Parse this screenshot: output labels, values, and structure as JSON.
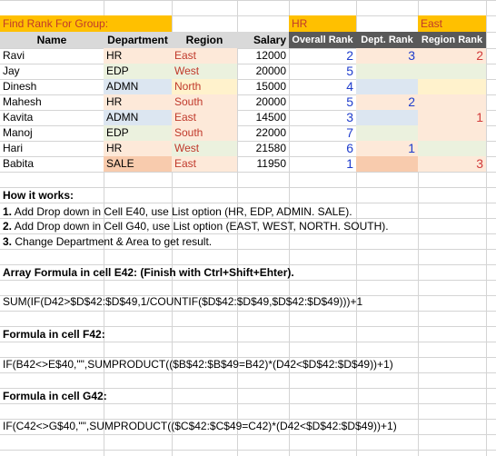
{
  "sheet": {
    "title": "Find Rank For Group:",
    "selected_department": "HR",
    "selected_region": "East",
    "headers": [
      "Name",
      "Department",
      "Region",
      "Salary",
      "Overall Rank",
      "Dept. Rank",
      "Region Rank"
    ],
    "rows": [
      {
        "name": "Ravi",
        "dept": "HR",
        "region": "East",
        "salary": "12000",
        "overall": "2",
        "dept_rank": "3",
        "region_rank": "2"
      },
      {
        "name": "Jay",
        "dept": "EDP",
        "region": "West",
        "salary": "20000",
        "overall": "5",
        "dept_rank": "",
        "region_rank": ""
      },
      {
        "name": "Dinesh",
        "dept": "ADMN",
        "region": "North",
        "salary": "15000",
        "overall": "4",
        "dept_rank": "",
        "region_rank": ""
      },
      {
        "name": "Mahesh",
        "dept": "HR",
        "region": "South",
        "salary": "20000",
        "overall": "5",
        "dept_rank": "2",
        "region_rank": ""
      },
      {
        "name": "Kavita",
        "dept": "ADMN",
        "region": "East",
        "salary": "14500",
        "overall": "3",
        "dept_rank": "",
        "region_rank": "1"
      },
      {
        "name": "Manoj",
        "dept": "EDP",
        "region": "South",
        "salary": "22000",
        "overall": "7",
        "dept_rank": "",
        "region_rank": ""
      },
      {
        "name": "Hari",
        "dept": "HR",
        "region": "West",
        "salary": "21580",
        "overall": "6",
        "dept_rank": "1",
        "region_rank": ""
      },
      {
        "name": "Babita",
        "dept": "SALE",
        "region": "East",
        "salary": "11950",
        "overall": "1",
        "dept_rank": "",
        "region_rank": "3"
      }
    ],
    "how_title": "How it works:",
    "steps": [
      {
        "num": "1.",
        "text": " Add Drop down in Cell E40, use List option (HR, EDP, ADMIN. SALE)."
      },
      {
        "num": "2.",
        "text": " Add Drop down in Cell G40, use List option (EAST, WEST, NORTH. SOUTH)."
      },
      {
        "num": "3.",
        "text": " Change Department & Area to get result."
      }
    ],
    "array_title": "Array Formula in cell E42: (Finish with Ctrl+Shift+Ehter).",
    "array_formula": "SUM(IF(D42>$D$42:$D$49,1/COUNTIF($D$42:$D$49,$D$42:$D$49)))+1",
    "f42_title": "Formula in cell F42:",
    "f42_formula": "IF(B42<>E$40,\"\",SUMPRODUCT(($B$42:$B$49=B42)*(D42<$D$42:$D$49))+1)",
    "g42_title": "Formula in cell G42:",
    "g42_formula": "IF(C42<>G$40,\"\",SUMPRODUCT(($C$42:$C$49=C42)*(D42<$D$42:$D$49))+1)"
  },
  "colors": {
    "dept": {
      "HR": "#fde9d9",
      "EDP": "#ebf1de",
      "ADMN": "#dce6f1",
      "SALE": "#f8cbad"
    },
    "region": {
      "East": "#fde9d9",
      "West": "#ebf1de",
      "North": "#fff2cc",
      "South": "#fde9d9"
    },
    "region_text": {
      "East": "#c0392b",
      "West": "#c0392b",
      "North": "#c0392b",
      "South": "#c0392b"
    }
  }
}
